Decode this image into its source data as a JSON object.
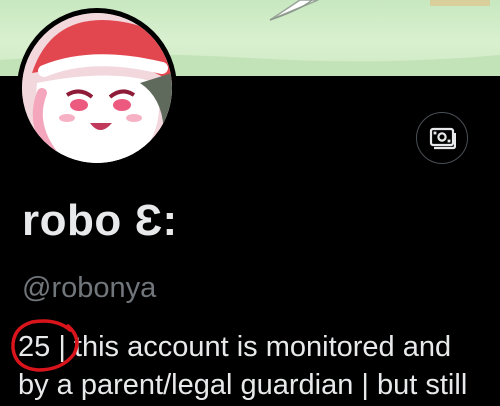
{
  "profile": {
    "display_name": "robo Ɛ:",
    "handle": "@robonya",
    "bio_age": "25",
    "bio_line1_rest": " | this account is monitored and",
    "bio_line2": "by a parent/legal guardian | but still"
  },
  "icons": {
    "tip": "money-icon"
  },
  "colors": {
    "background": "#000000",
    "primary_text": "#e7e9ea",
    "secondary_text": "#71767b",
    "annotation": "#d9141b"
  }
}
